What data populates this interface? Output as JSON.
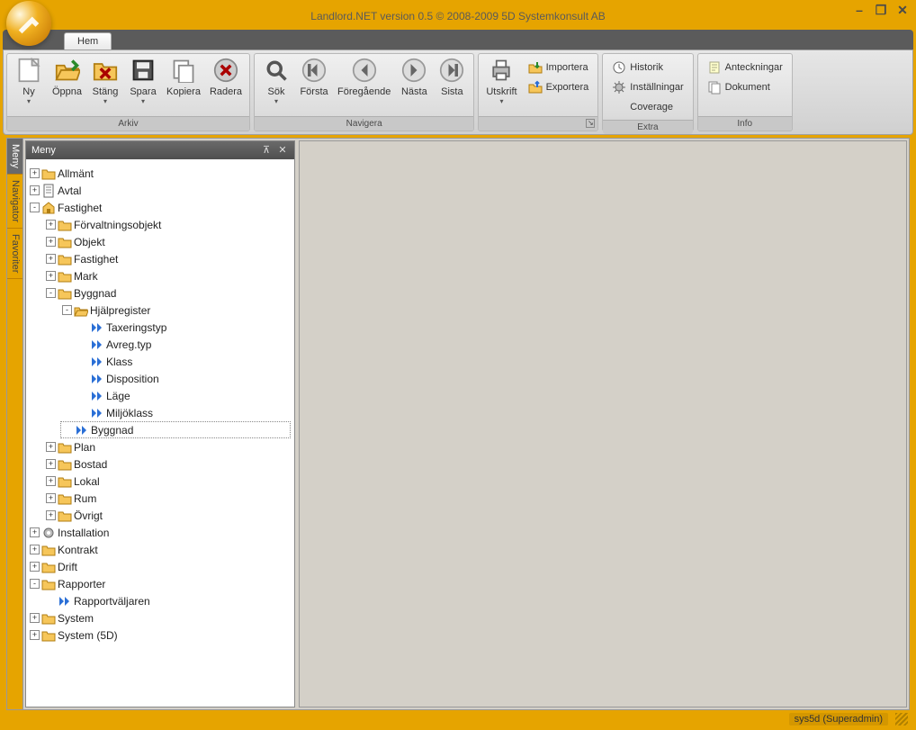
{
  "window": {
    "title": "Landlord.NET version 0.5 © 2008-2009 5D Systemkonsult AB",
    "min": "–",
    "restore": "❐",
    "close": "✕"
  },
  "tabs": {
    "active": "Hem"
  },
  "ribbon": {
    "groups": [
      {
        "name": "Arkiv",
        "buttons": [
          "Ny",
          "Öppna",
          "Stäng",
          "Spara",
          "Kopiera",
          "Radera"
        ],
        "drops": [
          "Ny",
          "Stäng",
          "Spara"
        ]
      },
      {
        "name": "Navigera",
        "buttons": [
          "Sök",
          "Första",
          "Föregående",
          "Nästa",
          "Sista"
        ],
        "drops": [
          "Sök"
        ]
      },
      {
        "name": "",
        "big": [
          "Utskrift"
        ],
        "big_drops": [
          "Utskrift"
        ],
        "small": [
          "Importera",
          "Exportera"
        ],
        "label": ""
      },
      {
        "name": "Extra",
        "small": [
          "Historik",
          "Inställningar",
          "Coverage"
        ]
      },
      {
        "name": "Info",
        "small": [
          "Anteckningar",
          "Dokument"
        ]
      }
    ],
    "labels": {
      "arkiv": "Arkiv",
      "navigera": "Navigera",
      "extra": "Extra",
      "info": "Info"
    }
  },
  "side_tabs": [
    "Meny",
    "Navigator",
    "Favoriter"
  ],
  "panel": {
    "title": "Meny",
    "pin": "⊼",
    "close": "✕"
  },
  "tree": [
    {
      "l": "Allmänt",
      "e": "+",
      "i": "folder"
    },
    {
      "l": "Avtal",
      "e": "+",
      "i": "doc"
    },
    {
      "l": "Fastighet",
      "e": "-",
      "i": "house",
      "c": [
        {
          "l": "Förvaltningsobjekt",
          "e": "+",
          "i": "folder"
        },
        {
          "l": "Objekt",
          "e": "+",
          "i": "folder"
        },
        {
          "l": "Fastighet",
          "e": "+",
          "i": "folder"
        },
        {
          "l": "Mark",
          "e": "+",
          "i": "folder"
        },
        {
          "l": "Byggnad",
          "e": "-",
          "i": "folder",
          "c": [
            {
              "l": "Hjälpregister",
              "e": "-",
              "i": "folder-open",
              "c": [
                {
                  "l": "Taxeringstyp",
                  "e": "",
                  "i": "arrow"
                },
                {
                  "l": "Avreg.typ",
                  "e": "",
                  "i": "arrow"
                },
                {
                  "l": "Klass",
                  "e": "",
                  "i": "arrow"
                },
                {
                  "l": "Disposition",
                  "e": "",
                  "i": "arrow"
                },
                {
                  "l": "Läge",
                  "e": "",
                  "i": "arrow"
                },
                {
                  "l": "Miljöklass",
                  "e": "",
                  "i": "arrow"
                }
              ]
            },
            {
              "l": "Byggnad",
              "e": "",
              "i": "arrow",
              "sel": true
            }
          ]
        },
        {
          "l": "Plan",
          "e": "+",
          "i": "folder"
        },
        {
          "l": "Bostad",
          "e": "+",
          "i": "folder"
        },
        {
          "l": "Lokal",
          "e": "+",
          "i": "folder"
        },
        {
          "l": "Rum",
          "e": "+",
          "i": "folder"
        },
        {
          "l": "Övrigt",
          "e": "+",
          "i": "folder"
        }
      ]
    },
    {
      "l": "Installation",
      "e": "+",
      "i": "gear"
    },
    {
      "l": "Kontrakt",
      "e": "+",
      "i": "folder"
    },
    {
      "l": "Drift",
      "e": "+",
      "i": "folder"
    },
    {
      "l": "Rapporter",
      "e": "-",
      "i": "folder",
      "c": [
        {
          "l": "Rapportväljaren",
          "e": "",
          "i": "arrow"
        }
      ]
    },
    {
      "l": "System",
      "e": "+",
      "i": "folder"
    },
    {
      "l": "System (5D)",
      "e": "+",
      "i": "folder"
    }
  ],
  "status": {
    "user": "sys5d (Superadmin)"
  }
}
